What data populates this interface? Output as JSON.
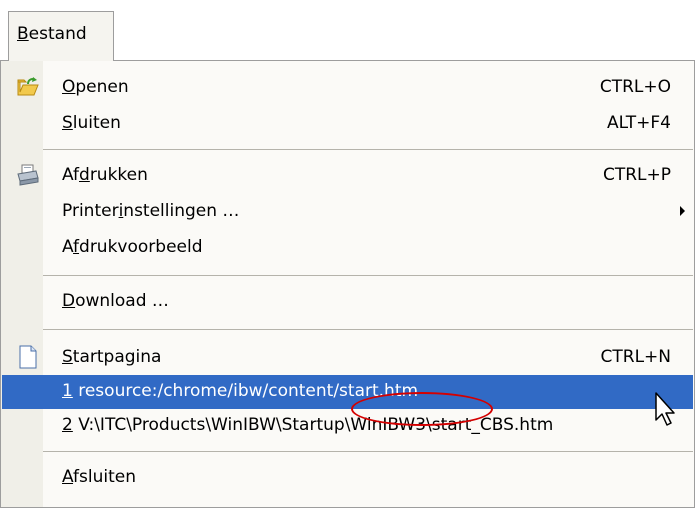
{
  "menubar": {
    "tab": {
      "label": "Bestand",
      "accel": "B",
      "rest": "estand"
    }
  },
  "menu": {
    "items": [
      {
        "id": "openen",
        "pre": "",
        "accel": "O",
        "post": "penen",
        "shortcut": "CTRL+O",
        "icon": "open-folder-icon"
      },
      {
        "id": "sluiten",
        "pre": "",
        "accel": "S",
        "post": "luiten",
        "shortcut": "ALT+F4"
      },
      {
        "id": "afdrukken",
        "pre": "Af",
        "accel": "d",
        "post": "rukken",
        "shortcut": "CTRL+P",
        "icon": "printer-icon"
      },
      {
        "id": "printerinstellingen",
        "pre": "Printer",
        "accel": "i",
        "post": "nstellingen …",
        "submenu": true
      },
      {
        "id": "afdrukvoorbeeld",
        "pre": "A",
        "accel": "f",
        "post": "drukvoorbeeld"
      },
      {
        "id": "download",
        "pre": "",
        "accel": "D",
        "post": "ownload …"
      },
      {
        "id": "startpagina",
        "pre": "",
        "accel": "S",
        "post": "tartpagina",
        "shortcut": "CTRL+N",
        "icon": "page-icon"
      },
      {
        "id": "recent1",
        "pre": "",
        "accel": "1",
        "post": " resource:/chrome/ibw/content/start.htm",
        "selected": true
      },
      {
        "id": "recent2",
        "pre": "",
        "accel": "2",
        "post": " V:\\ITC\\Products\\WinIBW\\Startup\\WinIBW3\\start_CBS.htm"
      },
      {
        "id": "afsluiten",
        "pre": "",
        "accel": "A",
        "post": "fsluiten"
      }
    ]
  },
  "colors": {
    "selection": "#316ac5",
    "annotation": "#d40000"
  }
}
